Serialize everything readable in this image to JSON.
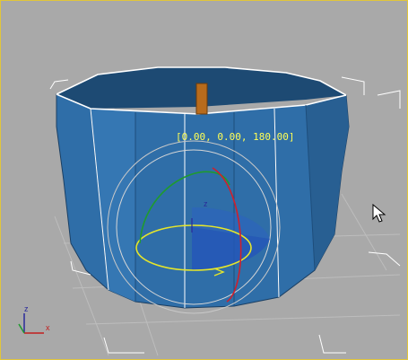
{
  "viewport": {
    "gizmo_readout": "[0.00, 0.00, 180.00]",
    "gizmo_axis_label": "z",
    "world_axis": {
      "z_label": "z",
      "x_label": "x"
    },
    "colors": {
      "background": "#a9a9a9",
      "object_fill": "#2f6ea8",
      "object_rim": "#ffffff",
      "selection_bracket": "#ffffff",
      "gizmo_x_ring": "#d11f2b",
      "gizmo_y_ring": "#1f9a2f",
      "gizmo_z_ring": "#e6e62a",
      "readout_text": "#ffff55",
      "border_active": "#e1c63a"
    },
    "icons": [
      "rotate-gizmo-icon",
      "world-axis-tripod-icon",
      "arrow-cursor-icon"
    ]
  }
}
